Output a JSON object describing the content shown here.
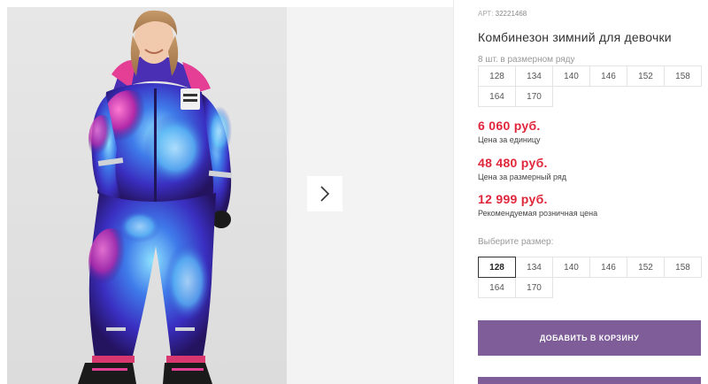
{
  "gallery": {
    "main_image": "girl-in-galaxy-print-winter-jumpsuit",
    "next_icon": "chevron-right-icon"
  },
  "product": {
    "sku_label": "АРТ:",
    "sku": "32221468",
    "title": "Комбинезон зимний для девочки",
    "pack_label": "8 шт. в размерном ряду",
    "pack_sizes": [
      "128",
      "134",
      "140",
      "146",
      "152",
      "158",
      "164",
      "170"
    ],
    "prices": [
      {
        "value": "6 060 руб.",
        "note": "Цена за единицу"
      },
      {
        "value": "48 480 руб.",
        "note": "Цена за размерный ряд"
      },
      {
        "value": "12 999 руб.",
        "note": "Рекомендуемая розничная цена"
      }
    ],
    "choose_size_label": "Выберите размер:",
    "choose_sizes": [
      "128",
      "134",
      "140",
      "146",
      "152",
      "158",
      "164",
      "170"
    ],
    "selected_size": "128",
    "add_to_cart_label": "ДОБАВИТЬ В КОРЗИНУ"
  },
  "colors": {
    "accent": "#7e5d99",
    "price": "#e0263a"
  }
}
